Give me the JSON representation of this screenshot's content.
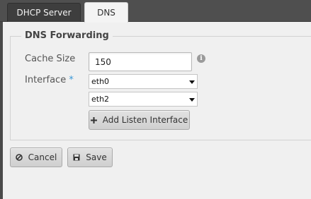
{
  "tabs": [
    {
      "label": "DHCP Server",
      "active": false
    },
    {
      "label": "DNS",
      "active": true
    }
  ],
  "section": {
    "title": "DNS Forwarding"
  },
  "form": {
    "cache_size": {
      "label": "Cache Size",
      "value": "150"
    },
    "interface": {
      "label": "Interface",
      "required_marker": "*",
      "selects": [
        {
          "selected": "eth0"
        },
        {
          "selected": "eth2"
        }
      ],
      "add_label": "Add Listen Interface"
    }
  },
  "actions": {
    "cancel_label": "Cancel",
    "save_label": "Save"
  },
  "icons": {
    "info": "info-icon",
    "add": "plus-icon",
    "cancel": "ban-icon",
    "save": "floppy-disk-icon"
  }
}
